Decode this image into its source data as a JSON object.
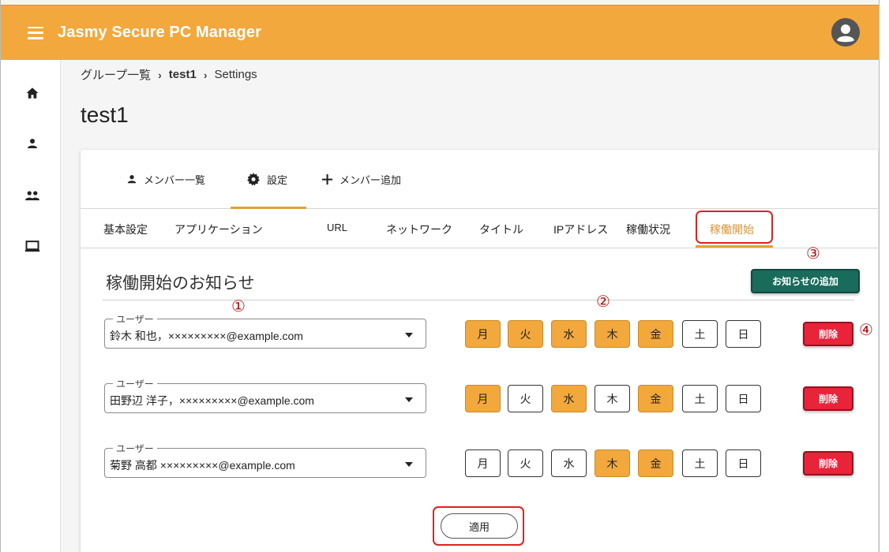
{
  "app": {
    "title": "Jasmy Secure PC Manager"
  },
  "icons": {
    "menu": "menu-icon",
    "avatar": "account-circle-icon",
    "home": "home-icon",
    "person": "person-icon",
    "group": "group-icon",
    "laptop": "laptop-icon",
    "gear": "gear-icon",
    "plus": "plus-icon",
    "dropdown": "chevron-down-icon"
  },
  "colors": {
    "appbar": "#f2a83c",
    "accent": "#e0a13a",
    "add_button": "#196b5c",
    "delete_button": "#e8233a",
    "callout": "#e02020"
  },
  "breadcrumb": {
    "item1": "グループ一覧",
    "sep": "›",
    "item2": "test1",
    "item3": "Settings"
  },
  "page": {
    "title": "test1"
  },
  "top_tabs": {
    "members": "メンバー一覧",
    "settings": "設定",
    "add_member": "メンバー追加",
    "active": "設定"
  },
  "sub_tabs": {
    "items": [
      "基本設定",
      "アプリケーション",
      "URL",
      "ネットワーク",
      "タイトル",
      "IPアドレス",
      "稼働状況",
      "稼働開始"
    ],
    "active": "稼働開始"
  },
  "section": {
    "title": "稼働開始のお知らせ",
    "add_button": "お知らせの追加"
  },
  "callouts": [
    "①",
    "②",
    "③",
    "④"
  ],
  "rows": [
    {
      "legend": "ユーザー",
      "value": "鈴木 和也，×××××××××@example.com",
      "days": [
        "月",
        "火",
        "水",
        "木",
        "金",
        "土",
        "日"
      ],
      "on": [
        true,
        true,
        true,
        true,
        true,
        false,
        false
      ],
      "delete": "削除"
    },
    {
      "legend": "ユーザー",
      "value": "田野辺 洋子，×××××××××@example.com",
      "days": [
        "月",
        "火",
        "水",
        "木",
        "金",
        "土",
        "日"
      ],
      "on": [
        true,
        false,
        true,
        false,
        true,
        false,
        false
      ],
      "delete": "削除"
    },
    {
      "legend": "ユーザー",
      "value": "菊野 高都 ×××××××××@example.com",
      "days": [
        "月",
        "火",
        "水",
        "木",
        "金",
        "土",
        "日"
      ],
      "on": [
        false,
        false,
        false,
        true,
        true,
        false,
        false
      ],
      "delete": "削除"
    }
  ],
  "apply_button": "適用"
}
